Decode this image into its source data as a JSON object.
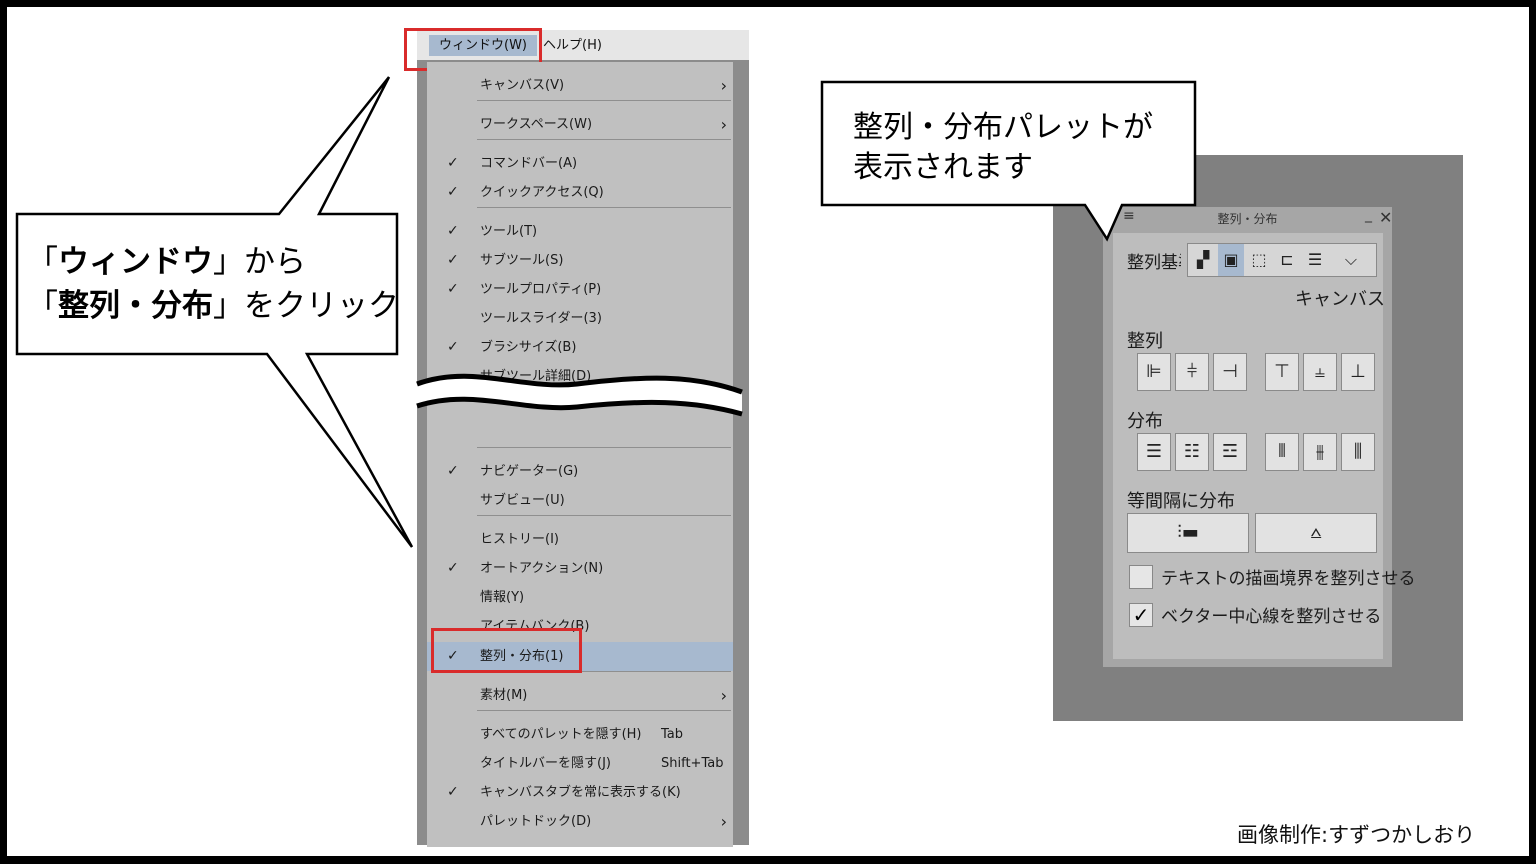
{
  "menubar": {
    "window_label": "ウィンドウ(W)",
    "help_label": "ヘルプ(H)"
  },
  "menu_items": [
    {
      "label": "キャンバス(V)",
      "checked": false,
      "shortcut": "",
      "submenu": true
    },
    {
      "label": "ワークスペース(W)",
      "checked": false,
      "shortcut": "",
      "submenu": true
    },
    {
      "label": "コマンドバー(A)",
      "checked": true,
      "shortcut": "",
      "submenu": false
    },
    {
      "label": "クイックアクセス(Q)",
      "checked": true,
      "shortcut": "",
      "submenu": false
    },
    {
      "label": "ツール(T)",
      "checked": true,
      "shortcut": "",
      "submenu": false
    },
    {
      "label": "サブツール(S)",
      "checked": true,
      "shortcut": "",
      "submenu": false
    },
    {
      "label": "ツールプロパティ(P)",
      "checked": true,
      "shortcut": "",
      "submenu": false
    },
    {
      "label": "ツールスライダー(3)",
      "checked": false,
      "shortcut": "",
      "submenu": false
    },
    {
      "label": "ブラシサイズ(B)",
      "checked": true,
      "shortcut": "",
      "submenu": false
    },
    {
      "label": "サブツール詳細(D)",
      "checked": false,
      "shortcut": "",
      "submenu": false
    },
    {
      "label": "ナビゲーター(G)",
      "checked": true,
      "shortcut": "",
      "submenu": false
    },
    {
      "label": "サブビュー(U)",
      "checked": false,
      "shortcut": "",
      "submenu": false
    },
    {
      "label": "ヒストリー(I)",
      "checked": false,
      "shortcut": "",
      "submenu": false
    },
    {
      "label": "オートアクション(N)",
      "checked": true,
      "shortcut": "",
      "submenu": false
    },
    {
      "label": "情報(Y)",
      "checked": false,
      "shortcut": "",
      "submenu": false
    },
    {
      "label": "アイテムバンク(B)",
      "checked": false,
      "shortcut": "",
      "submenu": false
    },
    {
      "label": "整列・分布(1)",
      "checked": true,
      "shortcut": "",
      "submenu": false
    },
    {
      "label": "素材(M)",
      "checked": false,
      "shortcut": "",
      "submenu": true
    },
    {
      "label": "すべてのパレットを隠す(H)",
      "checked": false,
      "shortcut": "Tab",
      "submenu": false
    },
    {
      "label": "タイトルバーを隠す(J)",
      "checked": false,
      "shortcut": "Shift+Tab",
      "submenu": false
    },
    {
      "label": "キャンバスタブを常に表示する(K)",
      "checked": true,
      "shortcut": "",
      "submenu": false
    },
    {
      "label": "パレットドック(D)",
      "checked": false,
      "shortcut": "",
      "submenu": true
    }
  ],
  "check_glyph": "✓",
  "callout_left": {
    "line1_bold": "ウィンドウ",
    "line1_rest": "から",
    "line2_bold": "整列・分布",
    "line2_rest": "をクリック",
    "open_quote": "「",
    "close_quote": "」"
  },
  "callout_right": {
    "line1": "整列・分布パレットが",
    "line2": "表示されます"
  },
  "palette": {
    "title": "整列・分布",
    "basis_label": "整列基準",
    "basis_value": "キャンバス",
    "align_label": "整列",
    "distribute_label": "分布",
    "equal_label": "等間隔に分布",
    "option1": "テキストの描画境界を整列させる",
    "option2": "ベクター中心線を整列させる",
    "option1_checked": false,
    "option2_checked": true
  },
  "credit": "画像制作:すずつかしおり",
  "colors": {
    "highlight": "#a7b9cf",
    "red_frame": "#d92b2b"
  }
}
